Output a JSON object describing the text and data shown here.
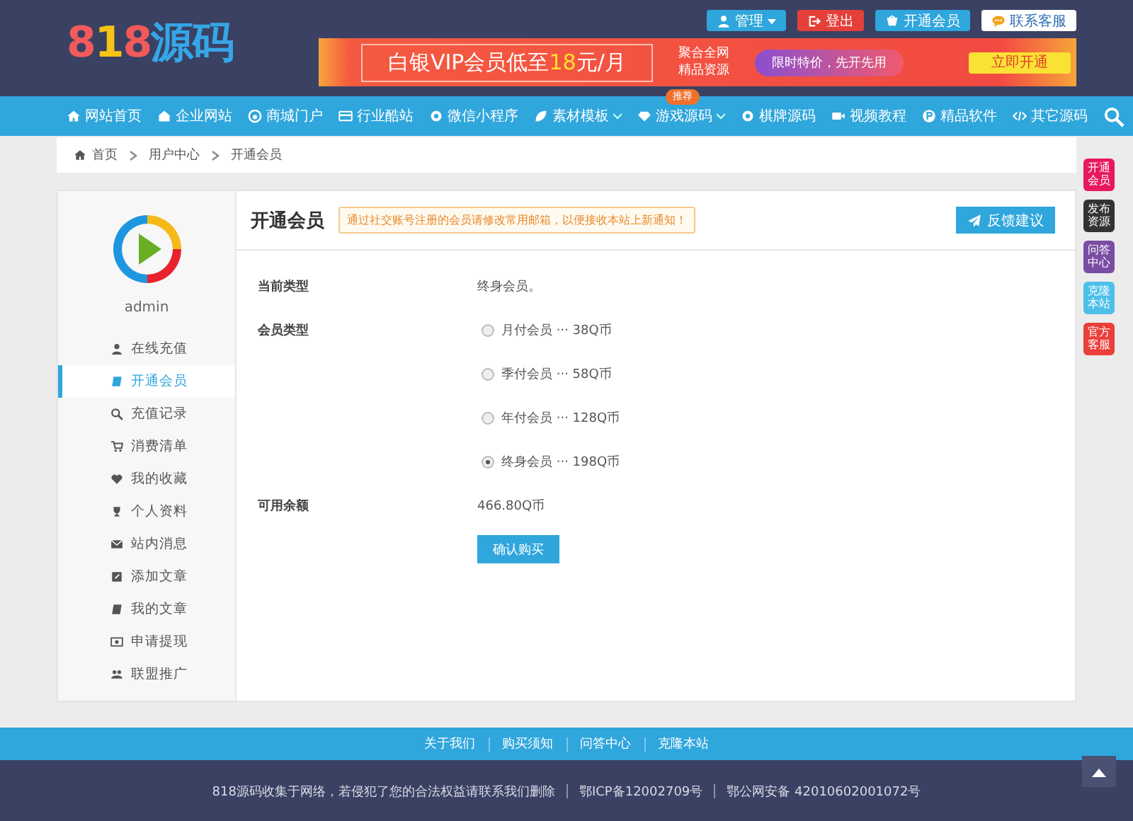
{
  "header": {
    "logo": "818源码",
    "top_buttons": [
      {
        "kind": "admin",
        "label": "管理"
      },
      {
        "kind": "logout",
        "label": "登出"
      },
      {
        "kind": "vip",
        "label": "开通会员"
      },
      {
        "kind": "service",
        "label": "联系客服"
      }
    ],
    "banner": {
      "headline": "白银VIP会员低至**18**元/月",
      "line_1": "聚合全网",
      "line_2": "精品资源",
      "offer": "限时特价，先开先用",
      "cta": "立即开通"
    }
  },
  "nav": {
    "items": [
      {
        "label": "网站首页"
      },
      {
        "label": "企业网站"
      },
      {
        "label": "商城门户"
      },
      {
        "label": "行业酷站"
      },
      {
        "label": "微信小程序"
      },
      {
        "label": "素材模板",
        "dropdown": true
      },
      {
        "label": "游戏源码",
        "dropdown": true,
        "badge": "推荐"
      },
      {
        "label": "棋牌源码"
      },
      {
        "label": "视频教程"
      },
      {
        "label": "精品软件"
      },
      {
        "label": "其它源码"
      }
    ]
  },
  "breadcrumb": [
    "首页",
    "用户中心",
    "开通会员"
  ],
  "sidebar": {
    "username": "admin",
    "items": [
      {
        "label": "在线充值",
        "selected": false
      },
      {
        "label": "开通会员",
        "selected": true
      },
      {
        "label": "充值记录",
        "selected": false
      },
      {
        "label": "消费清单",
        "selected": false
      },
      {
        "label": "我的收藏",
        "selected": false
      },
      {
        "label": "个人资料",
        "selected": false
      },
      {
        "label": "站内消息",
        "selected": false
      },
      {
        "label": "添加文章",
        "selected": false
      },
      {
        "label": "我的文章",
        "selected": false
      },
      {
        "label": "申请提现",
        "selected": false
      },
      {
        "label": "联盟推广",
        "selected": false
      }
    ]
  },
  "content": {
    "title": "开通会员",
    "notice": "通过社交账号注册的会员请修改常用邮箱，以便接收本站上新通知！",
    "feedback_button": "反馈建议",
    "current_label": "当前类型",
    "current_value": "终身会员。",
    "type_label": "会员类型",
    "options": [
      {
        "label": "月付会员 ··· 38Q币",
        "selected": false
      },
      {
        "label": "季付会员 ··· 58Q币",
        "selected": false
      },
      {
        "label": "年付会员 ··· 128Q币",
        "selected": false
      },
      {
        "label": "终身会员 ··· 198Q币",
        "selected": true
      }
    ],
    "balance_label": "可用余额",
    "balance_value": "466.80Q币",
    "submit": "确认购买"
  },
  "side_float": [
    {
      "label": "开通会员",
      "color": "#e8185c"
    },
    {
      "label": "发布资源",
      "color": "#333333"
    },
    {
      "label": "问答中心",
      "color": "#7a4da3"
    },
    {
      "label": "克隆本站",
      "color": "#4dc0ea"
    },
    {
      "label": "官方客服",
      "color": "#ea3f3a"
    }
  ],
  "footer": {
    "links": [
      "关于我们",
      "购买须知",
      "问答中心",
      "克隆本站"
    ],
    "copyright": "818源码收集于网络，若侵犯了您的合法权益请联系我们删除",
    "icp": "鄂ICP备12002709号",
    "police": "鄂公网安备 42010602001072号"
  }
}
